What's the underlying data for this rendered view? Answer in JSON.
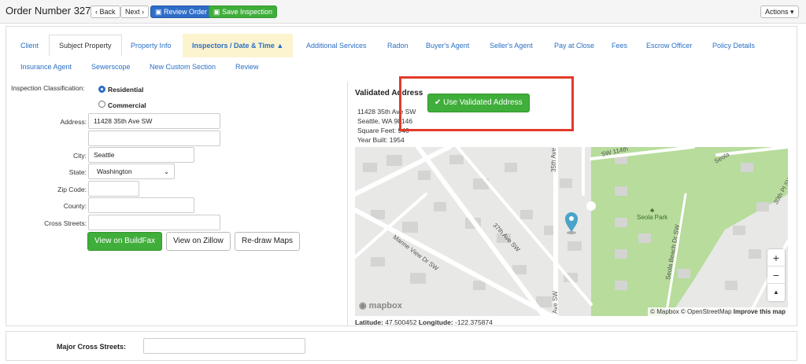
{
  "header": {
    "title": "Order Number 327",
    "back": "Back",
    "next": "Next",
    "review_order": "Review Order",
    "save_inspection": "Save Inspection",
    "actions": "Actions"
  },
  "tabs_row1": [
    "Client",
    "Subject Property",
    "Property Info",
    "Inspectors / Date & Time",
    "Additional Services",
    "Radon",
    "Buyer's Agent",
    "Seller's Agent",
    "Pay at Close",
    "Fees",
    "Escrow Officer",
    "Policy Details"
  ],
  "tabs_row2": [
    "Insurance Agent",
    "Sewerscope",
    "New Custom Section",
    "Review"
  ],
  "form": {
    "classification_label": "Inspection Classification:",
    "residential": "Residential",
    "commercial": "Commercial",
    "address_label": "Address:",
    "address_value": "11428 35th Ave SW",
    "city_label": "City:",
    "city_value": "Seattle",
    "state_label": "State:",
    "state_value": "Washington",
    "zip_label": "Zip Code:",
    "county_label": "County:",
    "cross_label": "Cross Streets:",
    "btn_buildfax": "View on BuildFax",
    "btn_zillow": "View on Zillow",
    "btn_redraw": "Re-draw Maps"
  },
  "validated": {
    "heading": "Validated Address",
    "use_button": "Use Validated Address",
    "line1": "11428 35th Ave SW",
    "line2": "Seattle, WA 98146",
    "line3": "Square Feet: 940",
    "line4": "Year Built: 1954"
  },
  "map": {
    "labels": {
      "ave35": "35th Ave SW",
      "marine": "Marine View Dr SW",
      "ave37": "37th Ave SW",
      "seola_park": "Seola Park",
      "seola_beach": "Seola Beach Dr SW",
      "pl30": "30th Pl SW",
      "sw114": "SW 114th",
      "seola": "Seola",
      "ave35b": "Ave SW"
    },
    "logo": "mapbox",
    "attribution": "© Mapbox © OpenStreetMap",
    "improve": "Improve this map",
    "zoom_in": "+",
    "zoom_out": "−",
    "compass": "▲"
  },
  "coords": {
    "lat_label": "Latitude:",
    "lat": "47.500452",
    "lon_label": "Longitude:",
    "lon": "-122.375874"
  },
  "lower": {
    "major_label": "Major Cross Streets:"
  },
  "colors": {
    "accent": "#2e6dc8",
    "success": "#3fae3a",
    "warn_tab": "#fcf3cf",
    "highlight": "#e23b2a",
    "park": "#b7dc9c"
  }
}
